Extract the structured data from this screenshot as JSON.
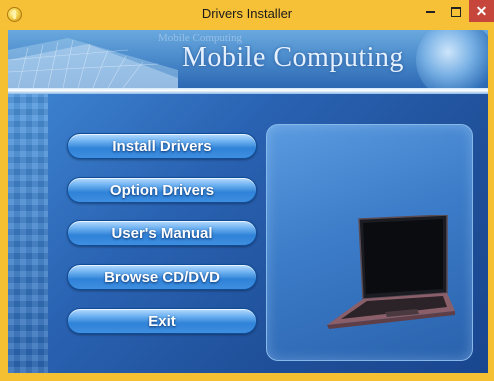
{
  "window": {
    "title": "Drivers Installer"
  },
  "banner": {
    "brand": "Mobile Computing",
    "brand_small": "Mobile Computing"
  },
  "menu": [
    {
      "label": "Install Drivers"
    },
    {
      "label": "Option Drivers"
    },
    {
      "label": "User's Manual"
    },
    {
      "label": "Browse CD/DVD"
    },
    {
      "label": "Exit"
    }
  ],
  "colors": {
    "titlebar": "#f6c136",
    "close_button": "#c7463b",
    "client_background": "#2f74c4",
    "button_fill": "#3f8fe0"
  }
}
